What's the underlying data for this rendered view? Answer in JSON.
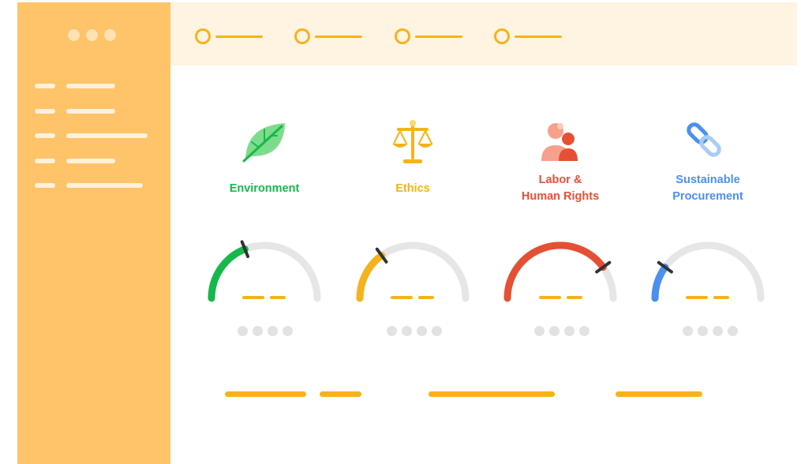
{
  "colors": {
    "sidebar": "#FFC369",
    "topbar": "#FFF4E1",
    "accent": "#F6B21D",
    "environment": "#17B84B",
    "ethics": "#F6B21D",
    "labor": "#E55035",
    "procurement": "#4A90F0",
    "gauge_track": "#E6E6E6"
  },
  "categories": [
    {
      "label": "Environment",
      "icon": "leaf-icon",
      "color": "#17B84B",
      "gauge_level": 0.38
    },
    {
      "label": "Ethics",
      "icon": "scales-icon",
      "color": "#F6B21D",
      "gauge_level": 0.3
    },
    {
      "label": "Labor &\nHuman Rights",
      "icon": "people-icon",
      "color": "#E55035",
      "gauge_level": 0.8
    },
    {
      "label": "Sustainable\nProcurement",
      "icon": "chain-link-icon",
      "color": "#4A90F0",
      "gauge_level": 0.2
    }
  ]
}
